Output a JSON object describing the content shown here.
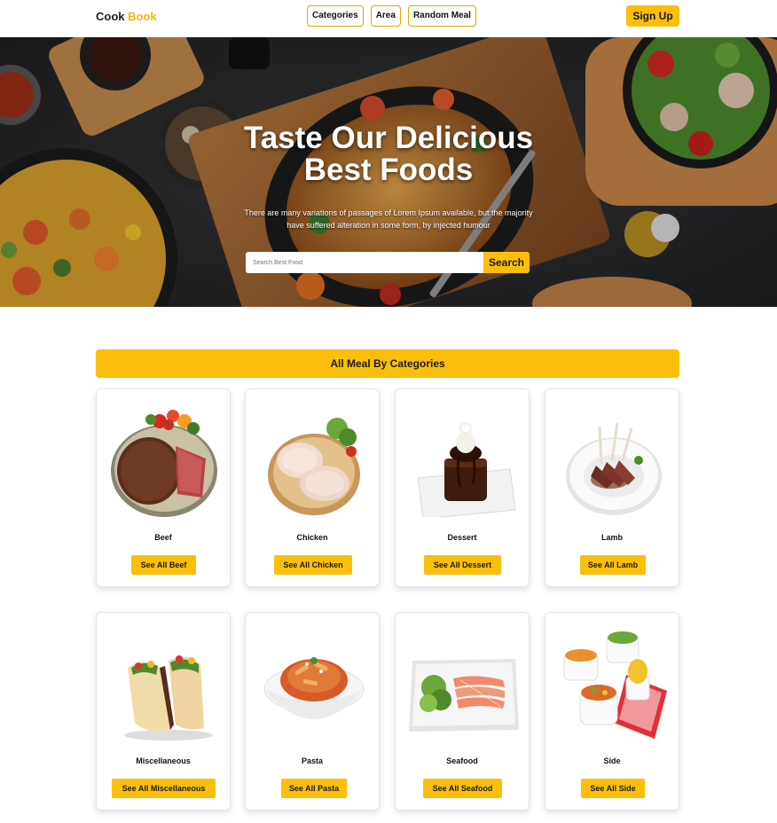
{
  "nav": {
    "brand_part1": "Cook",
    "brand_part2": "Book",
    "links": [
      "Categories",
      "Area",
      "Random Meal"
    ],
    "signup_label": "Sign Up"
  },
  "hero": {
    "title": "Taste Our Delicious Best Foods",
    "subtitle": "There are many variations of passages of Lorem Ipsum available, but the majority have suffered alteration in some form, by injected humour",
    "search_placeholder": "Search Best Food",
    "search_label": "Search"
  },
  "section": {
    "title": "All Meal By Categories"
  },
  "categories": [
    {
      "name": "Beef",
      "button": "See All Beef",
      "icon": "beef-steak-image"
    },
    {
      "name": "Chicken",
      "button": "See All Chicken",
      "icon": "chicken-image"
    },
    {
      "name": "Dessert",
      "button": "See All Dessert",
      "icon": "dessert-image"
    },
    {
      "name": "Lamb",
      "button": "See All Lamb",
      "icon": "lamb-image"
    },
    {
      "name": "Miscellaneous",
      "button": "See All Miscellaneous",
      "icon": "tacos-image"
    },
    {
      "name": "Pasta",
      "button": "See All Pasta",
      "icon": "pasta-image"
    },
    {
      "name": "Seafood",
      "button": "See All Seafood",
      "icon": "seafood-image"
    },
    {
      "name": "Side",
      "button": "See All Side",
      "icon": "side-dishes-image"
    }
  ],
  "colors": {
    "accent": "#fbbf0b",
    "brand_accent": "#f5b800"
  }
}
